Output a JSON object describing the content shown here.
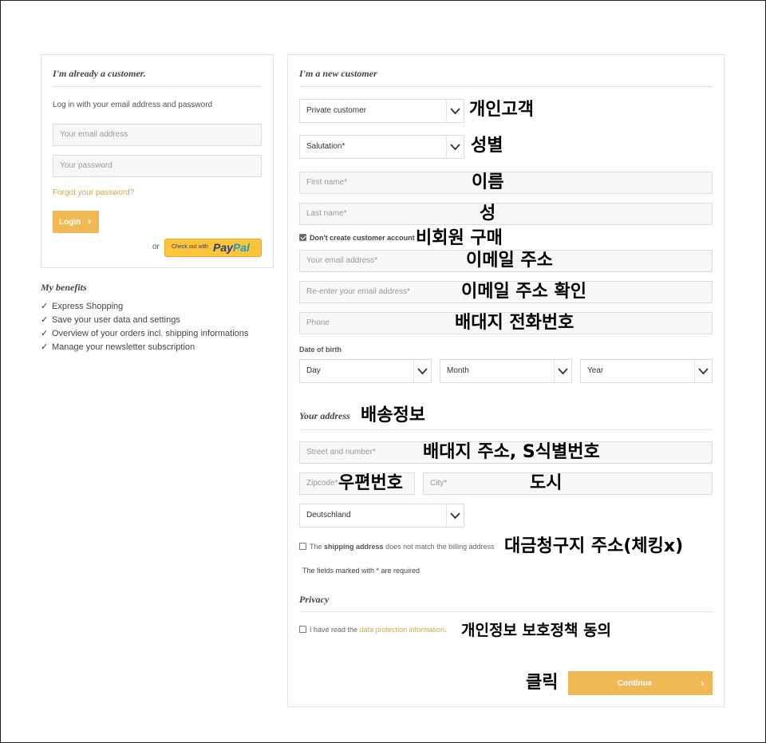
{
  "login": {
    "title": "I'm already a customer.",
    "description": "Log in with your email address and password",
    "email_placeholder": "Your email address",
    "password_placeholder": "Your password",
    "forgot_link": "Forgot your password?",
    "login_button": "Login",
    "or_label": "or",
    "paypal_prefix": "Check out with",
    "paypal_brand_1": "Pay",
    "paypal_brand_2": "Pal"
  },
  "benefits": {
    "title": "My benefits",
    "items": [
      "Express Shopping",
      "Save your user data and settings",
      "Overview of your orders incl. shipping informations",
      "Manage your newsletter subscription"
    ]
  },
  "register": {
    "title": "I'm a new customer",
    "customer_type": "Private customer",
    "salutation": "Salutation*",
    "first_name_placeholder": "First name*",
    "last_name_placeholder": "Last name*",
    "no_account_label": "Don't create customer account",
    "email_placeholder": "Your email address*",
    "email_repeat_placeholder": "Re-enter your email address*",
    "phone_placeholder": "Phone",
    "dob_label": "Date of birth",
    "day": "Day",
    "month": "Month",
    "year": "Year",
    "address_title": "Your address",
    "street_placeholder": "Street and number*",
    "zip_placeholder": "Zipcode*",
    "city_placeholder": "City*",
    "country": "Deutschland",
    "shipping_prefix": "The",
    "shipping_bold": "shipping address",
    "shipping_suffix": "does not match the billing address",
    "required_note": "The fields marked with * are required",
    "privacy_title": "Privacy",
    "privacy_prefix": "I have read the",
    "privacy_link": "data protection information",
    "privacy_suffix": ".",
    "continue_button": "Continue"
  },
  "annotations": {
    "customer_type": "개인고객",
    "salutation": "성별",
    "first_name": "이름",
    "last_name": "성",
    "no_account": "비회원 구매",
    "email": "이메일 주소",
    "email_repeat": "이메일 주소 확인",
    "phone": "배대지 전화번호",
    "address": "배송정보",
    "street": "배대지 주소, S식별번호",
    "zip": "우편번호",
    "city": "도시",
    "billing": "대금청구지 주소(체킹x)",
    "privacy": "개인정보 보호정책 동의",
    "click": "클릭"
  },
  "colors": {
    "accent": "#f1b955",
    "link": "#d7a64a",
    "paypal_button": "#ffc439",
    "paypal_dark_blue": "#253b80",
    "paypal_light_blue": "#179bd7"
  }
}
